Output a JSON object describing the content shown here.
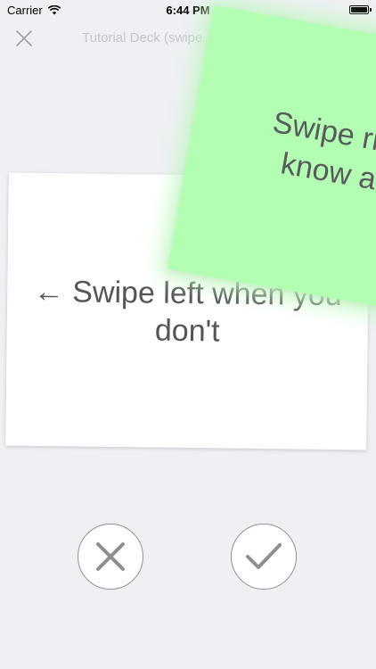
{
  "status_bar": {
    "carrier": "Carrier",
    "time": "6:44 PM"
  },
  "nav": {
    "title": "Tutorial Deck (swipe"
  },
  "cards": {
    "back_text": "← Swipe left when you don't",
    "front_line1": "Swipe right",
    "front_line2": "know a c"
  },
  "colors": {
    "background": "#efeff4",
    "front_card": "#b2feb2",
    "icon_gray": "#8e8e93"
  },
  "icons": {
    "close": "close-icon",
    "dont_know": "x-icon",
    "know": "check-icon"
  }
}
